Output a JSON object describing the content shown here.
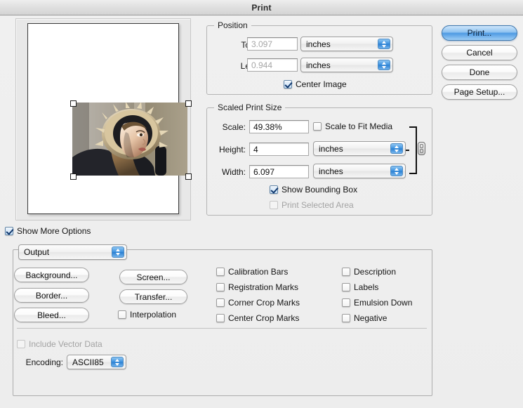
{
  "window": {
    "title": "Print"
  },
  "preview": {
    "alt": "print-preview-photo",
    "description": "Photo of a person wearing a fur-trimmed parka hood"
  },
  "position": {
    "legend": "Position",
    "top_label": "Top:",
    "top_value": "3.097",
    "top_units": "inches",
    "left_label": "Left:",
    "left_value": "0.944",
    "left_units": "inches",
    "center_image_label": "Center Image",
    "center_image_checked": true
  },
  "scaled": {
    "legend": "Scaled Print Size",
    "scale_label": "Scale:",
    "scale_value": "49.38%",
    "scale_to_fit_label": "Scale to Fit Media",
    "scale_to_fit_checked": false,
    "height_label": "Height:",
    "height_value": "4",
    "height_units": "inches",
    "width_label": "Width:",
    "width_value": "6.097",
    "width_units": "inches",
    "show_bounding_box_label": "Show Bounding Box",
    "show_bounding_box_checked": true,
    "print_selected_area_label": "Print Selected Area",
    "print_selected_area_checked": false
  },
  "actions": {
    "print": "Print...",
    "cancel": "Cancel",
    "done": "Done",
    "page_setup": "Page Setup..."
  },
  "more_options": {
    "label": "Show More Options",
    "checked": true
  },
  "output": {
    "section_value": "Output",
    "buttons_left": [
      "Background...",
      "Border...",
      "Bleed..."
    ],
    "buttons_mid": [
      "Screen...",
      "Transfer..."
    ],
    "interpolation_label": "Interpolation",
    "interpolation_checked": false,
    "column_a": [
      {
        "label": "Calibration Bars",
        "checked": false
      },
      {
        "label": "Registration Marks",
        "checked": false
      },
      {
        "label": "Corner Crop Marks",
        "checked": false
      },
      {
        "label": "Center Crop Marks",
        "checked": false
      }
    ],
    "column_b": [
      {
        "label": "Description",
        "checked": false
      },
      {
        "label": "Labels",
        "checked": false
      },
      {
        "label": "Emulsion Down",
        "checked": false
      },
      {
        "label": "Negative",
        "checked": false
      }
    ],
    "include_vector_label": "Include Vector Data",
    "include_vector_checked": false,
    "include_vector_disabled": true,
    "encoding_label": "Encoding:",
    "encoding_value": "ASCII85"
  },
  "colors": {
    "window_bg": "#efefef",
    "accent_blue": "#4e9ae3",
    "popup_arrow_blue": "#3f93e0",
    "text": "#141414",
    "disabled_text": "#a3a3a3"
  }
}
